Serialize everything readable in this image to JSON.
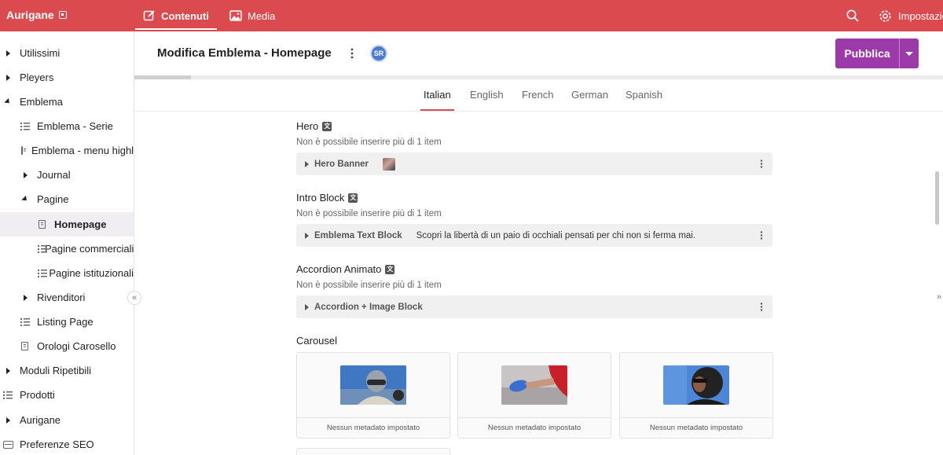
{
  "topbar": {
    "brand": "Aurigane",
    "tabs": [
      {
        "label": "Contenuti",
        "icon": "edit-icon"
      },
      {
        "label": "Media",
        "icon": "image-icon"
      }
    ],
    "settings_label": "Impostazioni",
    "color": "#db4a4e"
  },
  "sidebar": {
    "items": [
      {
        "label": "Utilissimi"
      },
      {
        "label": "Pleyers"
      },
      {
        "label": "Emblema"
      },
      {
        "label": "Emblema - Serie"
      },
      {
        "label": "Emblema - menu highlights"
      },
      {
        "label": "Journal"
      },
      {
        "label": "Pagine"
      },
      {
        "label": "Homepage"
      },
      {
        "label": "Pagine commerciali"
      },
      {
        "label": "Pagine istituzionali"
      },
      {
        "label": "Rivenditori"
      },
      {
        "label": "Listing Page"
      },
      {
        "label": "Orologi Carosello"
      },
      {
        "label": "Moduli Ripetibili"
      },
      {
        "label": "Prodotti"
      },
      {
        "label": "Aurigane"
      },
      {
        "label": "Preferenze SEO"
      }
    ],
    "collapse_glyph": "«"
  },
  "header": {
    "title": "Modifica Emblema - Homepage",
    "avatar_initials": "SR",
    "publish_label": "Pubblica",
    "publish_color": "#9b3aa8"
  },
  "languages": [
    "Italian",
    "English",
    "French",
    "German",
    "Spanish"
  ],
  "active_language": "Italian",
  "sections": [
    {
      "title": "Hero",
      "subtitle": "Non è possibile inserire più di 1 item",
      "block": {
        "name": "Hero Banner",
        "description": ""
      }
    },
    {
      "title": "Intro Block",
      "subtitle": "Non è possibile inserire più di 1 item",
      "block": {
        "name": "Emblema Text Block",
        "description": "Scopri la libertà di un paio di occhiali pensati per chi non si ferma mai."
      }
    },
    {
      "title": "Accordion Animato",
      "subtitle": "Non è possibile inserire più di 1 item",
      "block": {
        "name": "Accordion + Image Block",
        "description": ""
      }
    }
  ],
  "carousel": {
    "title": "Carousel",
    "cards": [
      {
        "caption": "Nessun metadato impostato"
      },
      {
        "caption": "Nessun metadato impostato"
      },
      {
        "caption": "Nessun metadato impostato"
      }
    ]
  },
  "translate_icon_glyph": "文"
}
